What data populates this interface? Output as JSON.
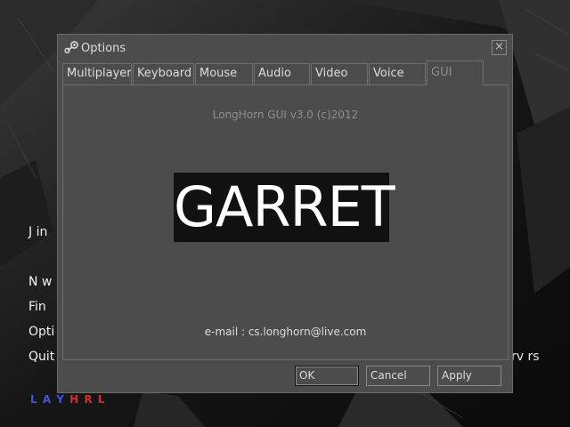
{
  "background_menu": {
    "items": [
      "J  in",
      "N  w",
      "Fin",
      "Opti",
      "Quit"
    ],
    "partial_right": "rv  rs",
    "brand_left": "L  A  Y",
    "brand_right": "H  R  L"
  },
  "dialog": {
    "title": "Options",
    "close_glyph": "×",
    "tabs": [
      {
        "label": "Multiplayer"
      },
      {
        "label": "Keyboard"
      },
      {
        "label": "Mouse"
      },
      {
        "label": "Audio"
      },
      {
        "label": "Video"
      },
      {
        "label": "Voice"
      },
      {
        "label": "GUI"
      }
    ],
    "active_tab": "GUI",
    "panel": {
      "version": "LongHorn GUI v3.0 (c)2012",
      "logo_text": "GARRET",
      "email": "e-mail : cs.longhorn@live.com"
    },
    "buttons": {
      "ok": "OK",
      "cancel": "Cancel",
      "apply": "Apply"
    }
  },
  "colors": {
    "dialog_bg": "#4c4c4c",
    "border": "#6e6e6e",
    "text": "#dcdcdc",
    "inactive_text": "#8c8c8c",
    "logo_bg": "#111111"
  },
  "icons": {
    "title_icon": "steam-icon",
    "close_icon": "close-icon"
  }
}
